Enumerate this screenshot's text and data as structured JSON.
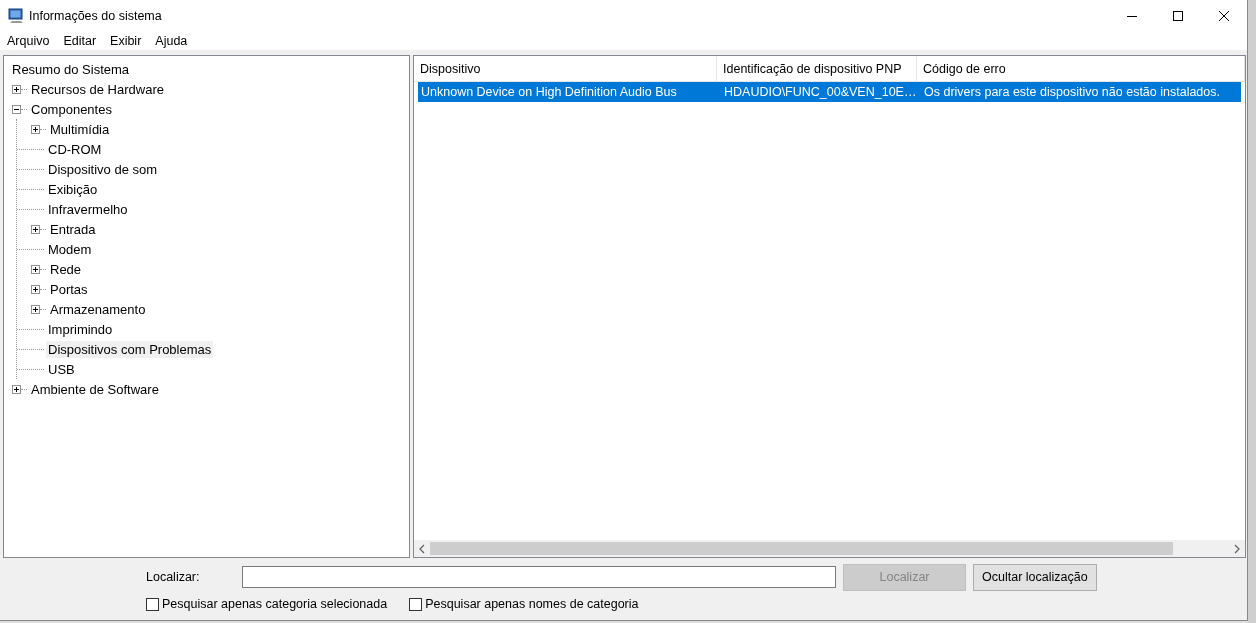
{
  "window": {
    "title": "Informações do sistema"
  },
  "menu": [
    "Arquivo",
    "Editar",
    "Exibir",
    "Ajuda"
  ],
  "tree": {
    "items": [
      {
        "label": "Resumo do Sistema",
        "selected": false
      },
      {
        "label": "Recursos de Hardware",
        "selected": false,
        "expanded": false
      },
      {
        "label": "Componentes",
        "selected": false,
        "expanded": true,
        "children": [
          {
            "label": "Multimídia",
            "selected": false,
            "expanded": false
          },
          {
            "label": "CD-ROM",
            "selected": false
          },
          {
            "label": "Dispositivo de som",
            "selected": false
          },
          {
            "label": "Exibição",
            "selected": false
          },
          {
            "label": "Infravermelho",
            "selected": false
          },
          {
            "label": "Entrada",
            "selected": false,
            "expanded": false
          },
          {
            "label": "Modem",
            "selected": false
          },
          {
            "label": "Rede",
            "selected": false,
            "expanded": false
          },
          {
            "label": "Portas",
            "selected": false,
            "expanded": false
          },
          {
            "label": "Armazenamento",
            "selected": false,
            "expanded": false
          },
          {
            "label": "Imprimindo",
            "selected": false
          },
          {
            "label": "Dispositivos com Problemas",
            "selected": true
          },
          {
            "label": "USB",
            "selected": false
          }
        ]
      },
      {
        "label": "Ambiente de Software",
        "selected": false,
        "expanded": false
      }
    ]
  },
  "table": {
    "columns": [
      "Dispositivo",
      "Identificação de dispositivo PNP",
      "Código de erro"
    ],
    "rows": [
      {
        "cells": [
          "Unknown Device on High Definition Audio Bus",
          "HDAUDIO\\FUNC_00&VEN_10E…",
          "Os drivers para este dispositivo não estão instalados."
        ],
        "selected": true
      }
    ]
  },
  "find": {
    "label": "Localizar:",
    "button": "Localizar",
    "button_disabled": true,
    "hide_button": "Ocultar localização",
    "options": [
      {
        "label": "Pesquisar apenas categoria selecionada",
        "checked": false
      },
      {
        "label": "Pesquisar apenas nomes de categoria",
        "checked": false
      }
    ]
  }
}
